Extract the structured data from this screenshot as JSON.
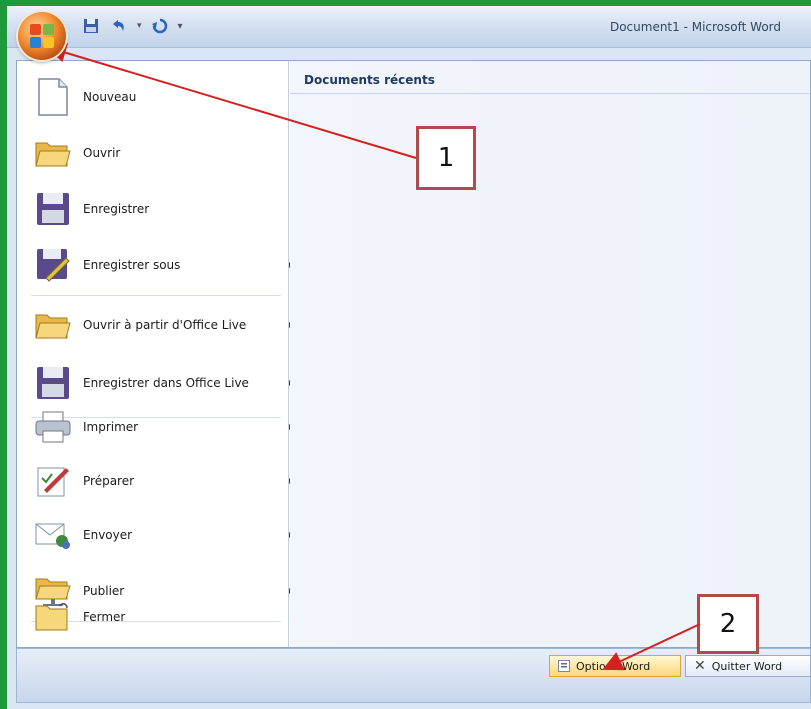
{
  "window": {
    "title": "Document1 - Microsoft Word"
  },
  "quick_access": {
    "save_icon": "save-icon",
    "undo_icon": "undo-icon",
    "redo_icon": "redo-icon",
    "customize_icon": "customize-qat-icon"
  },
  "office_menu": {
    "recent_header": "Documents récents",
    "items": [
      {
        "label": "Nouveau",
        "icon": "new-document-icon",
        "has_submenu": false
      },
      {
        "label": "Ouvrir",
        "icon": "open-folder-icon",
        "has_submenu": false
      },
      {
        "label": "Enregistrer",
        "icon": "save-floppy-icon",
        "has_submenu": false
      },
      {
        "label": "Enregistrer sous",
        "icon": "save-as-icon",
        "has_submenu": true
      },
      {
        "label": "Ouvrir à partir d'Office Live",
        "icon": "open-office-live-icon",
        "has_submenu": true
      },
      {
        "label": "Enregistrer dans Office Live",
        "icon": "save-office-live-icon",
        "has_submenu": true
      },
      {
        "label": "Imprimer",
        "icon": "printer-icon",
        "has_submenu": true
      },
      {
        "label": "Préparer",
        "icon": "prepare-icon",
        "has_submenu": true
      },
      {
        "label": "Envoyer",
        "icon": "send-icon",
        "has_submenu": true
      },
      {
        "label": "Publier",
        "icon": "publish-icon",
        "has_submenu": true
      },
      {
        "label": "Fermer",
        "icon": "close-folder-icon",
        "has_submenu": false
      }
    ],
    "options_button": "Options Word",
    "quit_button": "Quitter Word"
  },
  "annotations": {
    "callout_1": "1",
    "callout_2": "2"
  },
  "colors": {
    "background_green": "#1e9a3c",
    "annotation_red": "#d62020",
    "callout_border": "#b04b4b",
    "menu_blue": "#dbe6f4"
  }
}
